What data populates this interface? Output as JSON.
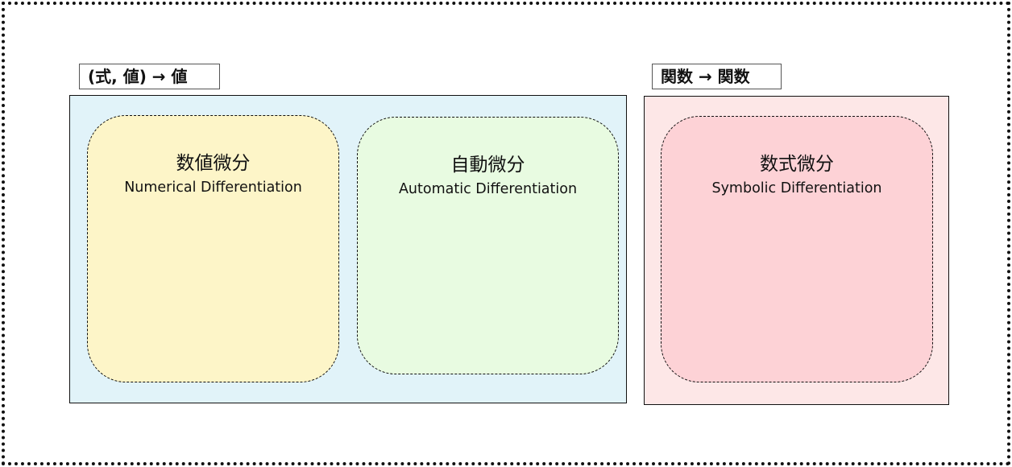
{
  "colors": {
    "group_value_bg": "#e1f3f9",
    "group_function_bg": "#fde7e7",
    "numerical_bg": "#fdf5c8",
    "automatic_bg": "#e8fbe1",
    "symbolic_bg": "#fdd2d6",
    "stroke": "#111111"
  },
  "groups": [
    {
      "label": "(式, 値) → 値",
      "methods": [
        {
          "name_ja": "数値微分",
          "name_en": "Numerical Differentiation"
        },
        {
          "name_ja": "自動微分",
          "name_en": "Automatic Differentiation"
        }
      ]
    },
    {
      "label": "関数 → 関数",
      "methods": [
        {
          "name_ja": "数式微分",
          "name_en": "Symbolic Differentiation"
        }
      ]
    }
  ]
}
